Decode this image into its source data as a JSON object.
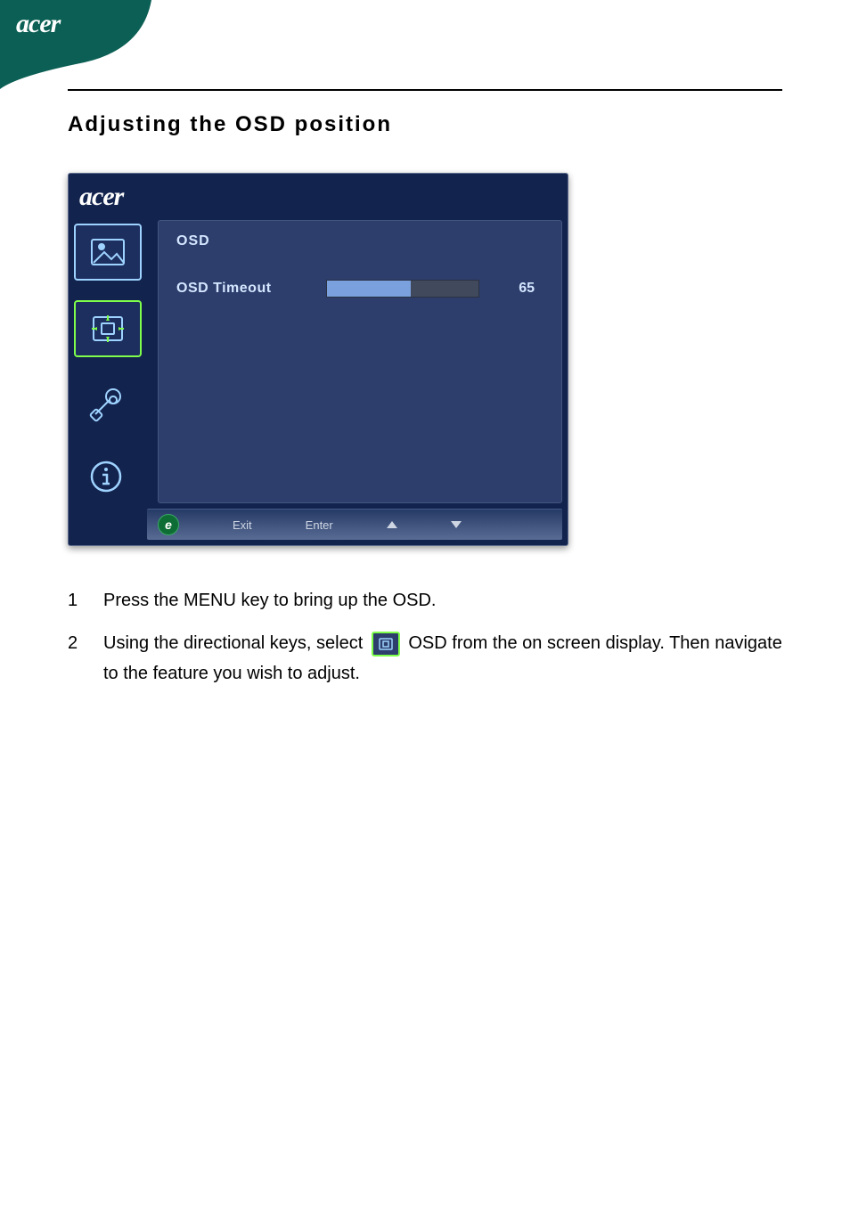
{
  "page": {
    "brand": "acer",
    "heading": "Adjusting the OSD position"
  },
  "osd": {
    "brand": "acer",
    "title": "OSD",
    "row": {
      "label": "OSD Timeout",
      "value": "65",
      "percent": 55
    },
    "footer": {
      "e": "e",
      "exit": "Exit",
      "enter": "Enter"
    }
  },
  "steps": [
    {
      "num": "1",
      "text": "Press the MENU key to bring up the OSD."
    },
    {
      "num": "2",
      "text_a": "Using the directional keys, select ",
      "text_b": " OSD from the on screen display. Then navigate to the feature you wish to adjust."
    }
  ]
}
